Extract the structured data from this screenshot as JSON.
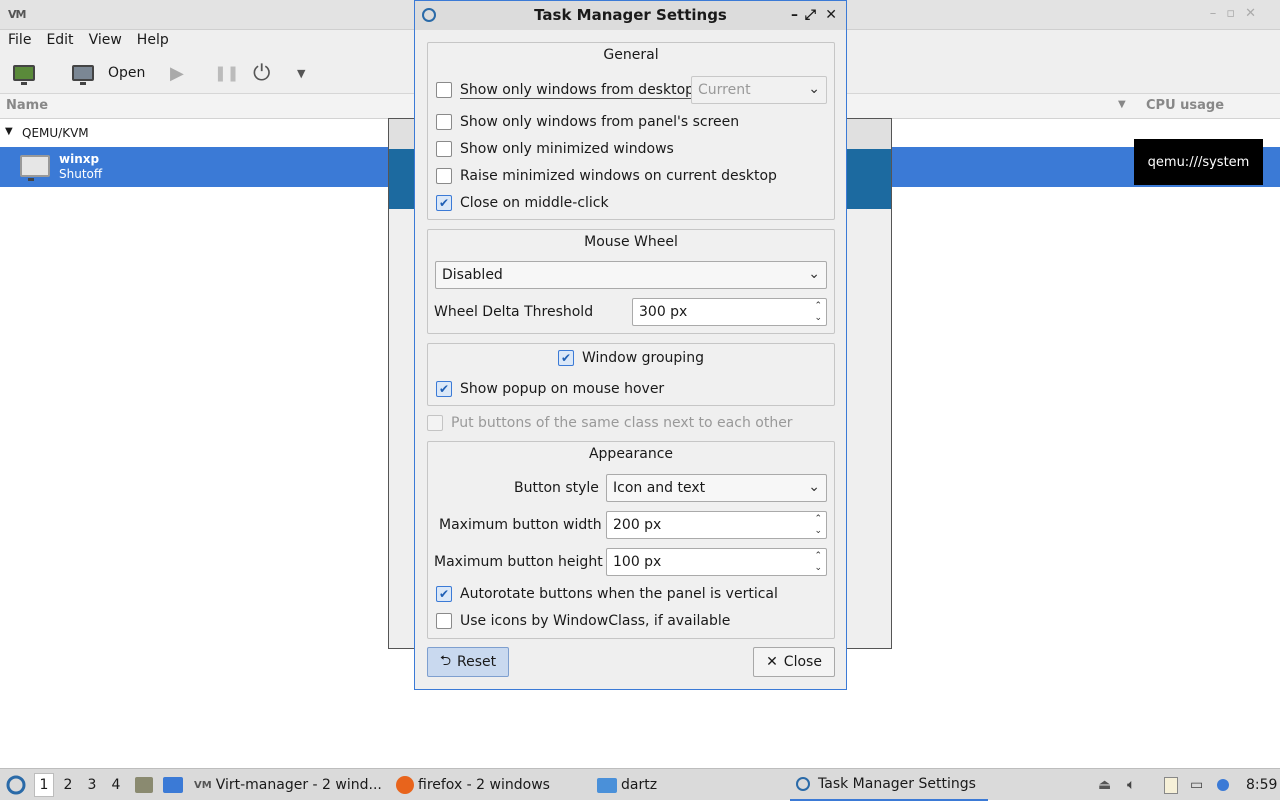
{
  "background_app": {
    "titlebar_icon": "VM",
    "menu": [
      "File",
      "Edit",
      "View",
      "Help"
    ],
    "toolbar": {
      "open_label": "Open"
    },
    "columns": {
      "name": "Name",
      "cpu": "CPU usage"
    },
    "group_label": "QEMU/KVM",
    "vm": {
      "name": "winxp",
      "state": "Shutoff"
    },
    "tooltip": "qemu:///system"
  },
  "dialog": {
    "title": "Task Manager Settings",
    "general": {
      "title": "General",
      "show_desktop_windows": "Show only windows from desktop",
      "desktop_combo": "Current",
      "show_panel_screen": "Show only windows from panel's screen",
      "show_minimized": "Show only minimized windows",
      "raise_minimized": "Raise minimized windows on current desktop",
      "close_middle": "Close on middle-click"
    },
    "mouse_wheel": {
      "title": "Mouse Wheel",
      "mode": "Disabled",
      "threshold_label": "Wheel Delta Threshold",
      "threshold_value": "300 px"
    },
    "grouping": {
      "window_grouping": "Window grouping",
      "popup_hover": "Show popup on mouse hover"
    },
    "same_class": "Put buttons of the same class next to each other",
    "appearance": {
      "title": "Appearance",
      "button_style_label": "Button style",
      "button_style_value": "Icon and text",
      "max_width_label": "Maximum button width",
      "max_width_value": "200 px",
      "max_height_label": "Maximum button height",
      "max_height_value": "100 px",
      "autorotate": "Autorotate buttons when the panel is vertical",
      "use_icons": "Use icons by WindowClass, if available"
    },
    "reset_label": "Reset",
    "close_label": "Close"
  },
  "taskbar": {
    "desktops": [
      "1",
      "2",
      "3",
      "4"
    ],
    "tasks": [
      "Virt-manager - 2 wind...",
      "firefox - 2 windows",
      "dartz",
      "Task Manager Settings"
    ],
    "clock": "8:59"
  }
}
